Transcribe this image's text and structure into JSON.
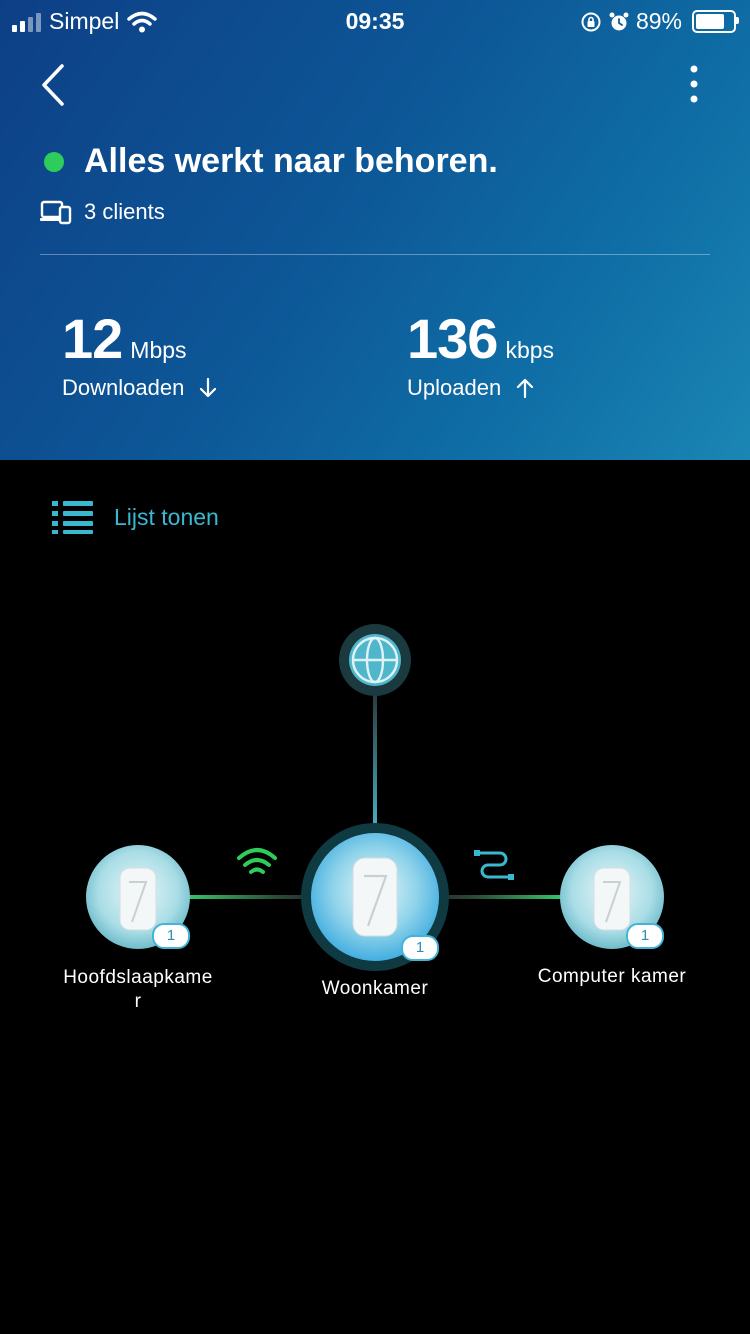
{
  "status_bar": {
    "carrier": "Simpel",
    "time": "09:35",
    "battery": "89%",
    "battery_level": 0.89
  },
  "header": {
    "status_title": "Alles werkt naar behoren.",
    "clients": "3 clients",
    "download": {
      "value": "12",
      "unit": "Mbps",
      "label": "Downloaden"
    },
    "upload": {
      "value": "136",
      "unit": "kbps",
      "label": "Uploaden"
    }
  },
  "list_toggle": {
    "label": "Lijst tonen"
  },
  "topology": {
    "nodes": [
      {
        "name": "Hoofdslaapkame\nr",
        "badge": "1",
        "link": "wifi"
      },
      {
        "name": "Woonkamer",
        "badge": "1",
        "link": "main"
      },
      {
        "name": "Computer kamer",
        "badge": "1",
        "link": "ethernet"
      }
    ]
  },
  "colors": {
    "accent": "#3ab8d0",
    "online": "#2ecc5a",
    "badge_border": "#43b4d6"
  }
}
